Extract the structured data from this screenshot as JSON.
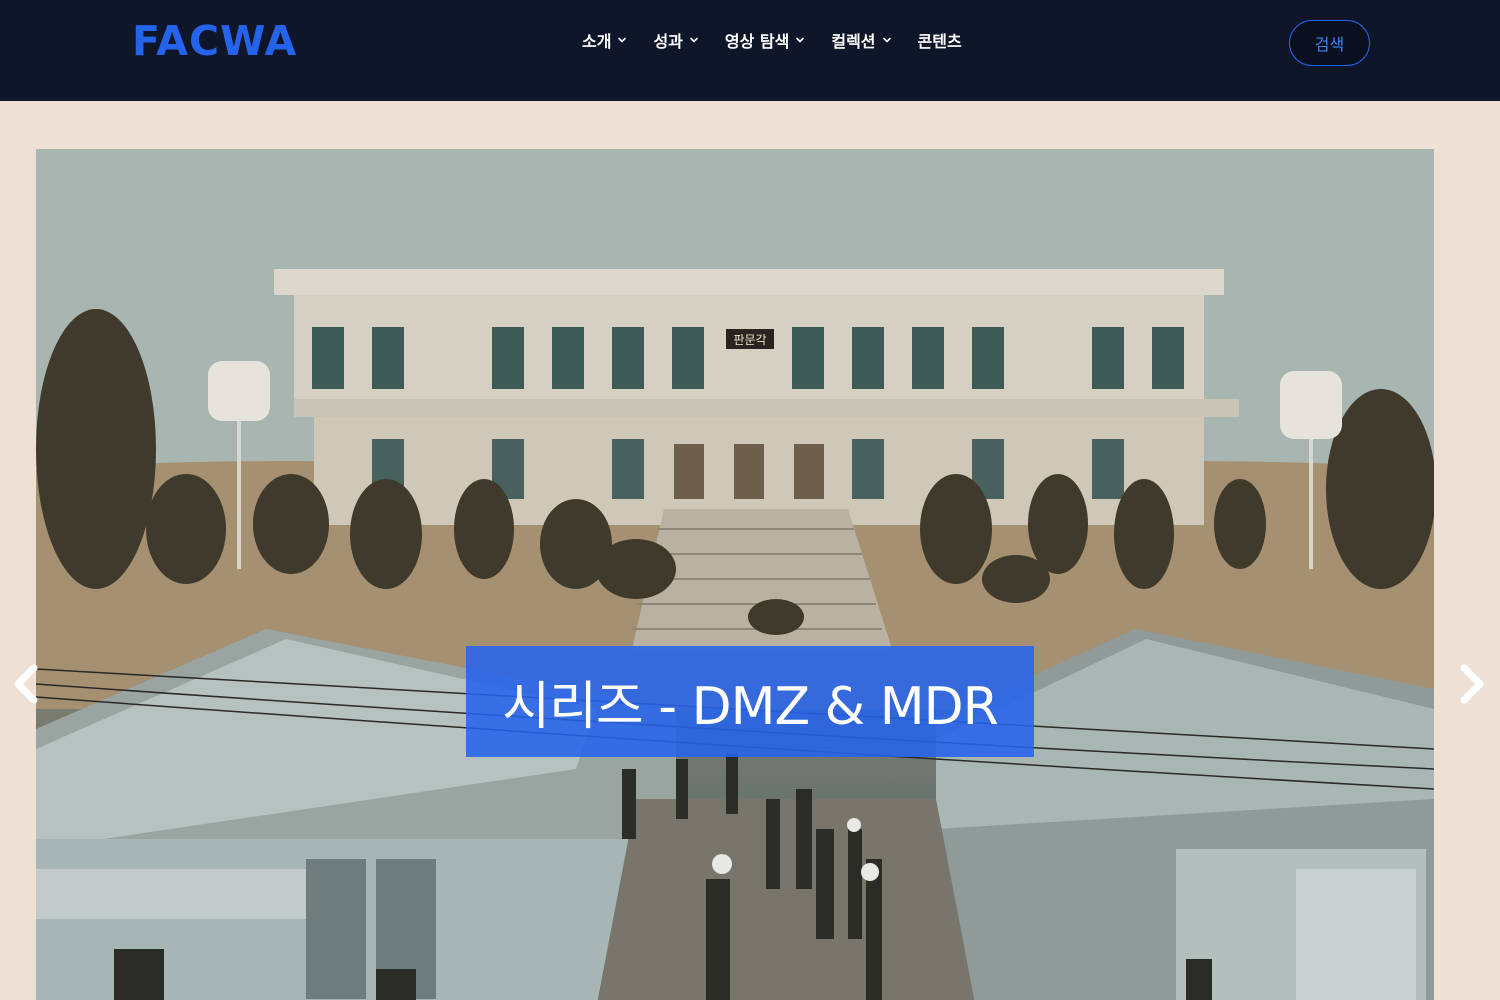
{
  "header": {
    "logo_text": "FACWA",
    "nav": [
      {
        "label": "소개",
        "has_dropdown": true
      },
      {
        "label": "성과",
        "has_dropdown": true
      },
      {
        "label": "영상 탐색",
        "has_dropdown": true
      },
      {
        "label": "컬렉션",
        "has_dropdown": true
      },
      {
        "label": "콘텐츠",
        "has_dropdown": false
      }
    ],
    "search_label": "검색"
  },
  "hero": {
    "caption": "시리즈 - DMZ & MDR",
    "prev_icon": "chevron-left-icon",
    "next_icon": "chevron-right-icon",
    "building_sign": "판문각"
  },
  "colors": {
    "header_bg": "#0f1629",
    "accent": "#2563eb",
    "caption_bg": "#2563eb",
    "photo_border": "#efe0d6"
  }
}
